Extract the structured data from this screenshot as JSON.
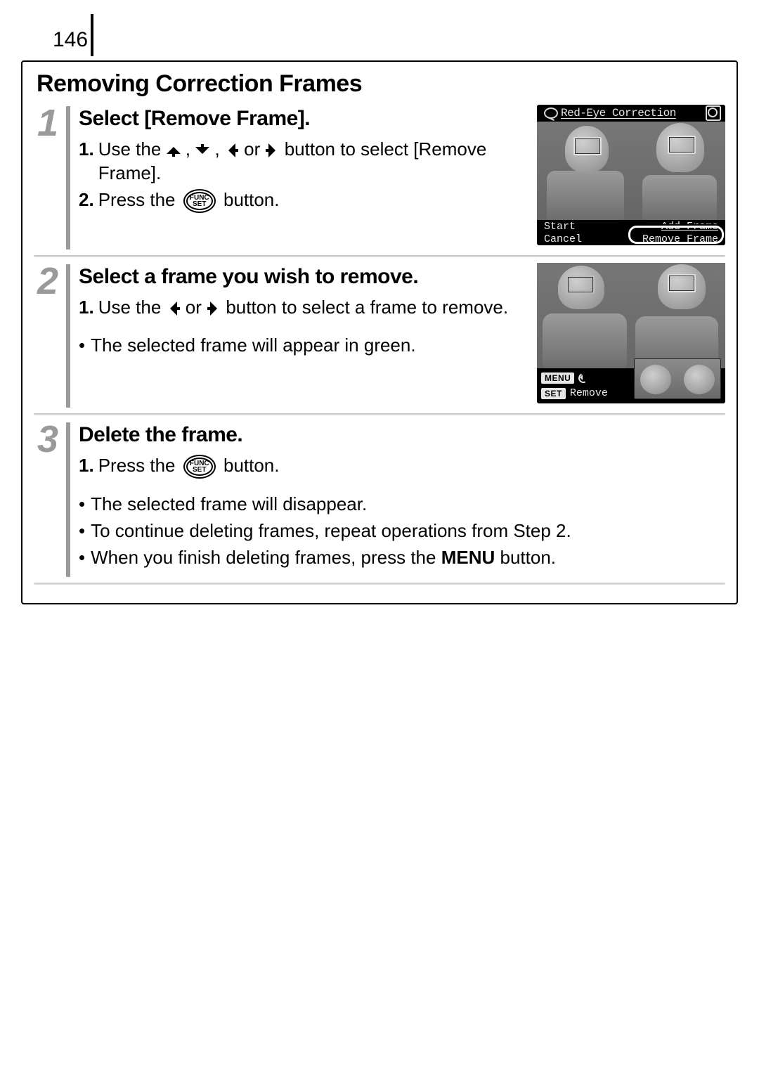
{
  "page_number": "146",
  "section_title": "Removing Correction Frames",
  "steps": [
    {
      "num": "1",
      "title": "Select [Remove Frame].",
      "ordered": [
        {
          "num": "1.",
          "pre": "Use the ",
          "mid_a": ", ",
          "mid_b": ", ",
          "mid_c": " or ",
          "post": " button to select [Remove Frame]."
        },
        {
          "num": "2.",
          "pre": "Press the ",
          "post": " button."
        }
      ],
      "lcd": {
        "top_title": "Red-Eye Correction",
        "bl_top": "Start",
        "bl_bot": "Cancel",
        "br_top": "Add Frame",
        "br_bot": "Remove Frame"
      }
    },
    {
      "num": "2",
      "title": "Select a frame you wish to remove.",
      "ordered": [
        {
          "num": "1.",
          "pre": "Use the ",
          "mid_c": " or ",
          "post": " button to select a frame to remove."
        }
      ],
      "bullets": [
        "The selected frame will appear in green."
      ],
      "lcd": {
        "menu_label": "MENU",
        "set_label": "SET",
        "set_text": "Remove"
      }
    },
    {
      "num": "3",
      "title": "Delete the frame.",
      "ordered": [
        {
          "num": "1.",
          "pre": "Press the ",
          "post": " button."
        }
      ],
      "bullets_rich": [
        {
          "text": "The selected frame will disappear."
        },
        {
          "text": "To continue deleting frames, repeat operations from Step 2."
        },
        {
          "pre": "When you finish deleting frames, press the ",
          "strong": "MENU",
          "post": " button."
        }
      ]
    }
  ],
  "funcset_top": "FUNC",
  "funcset_bot": "SET"
}
